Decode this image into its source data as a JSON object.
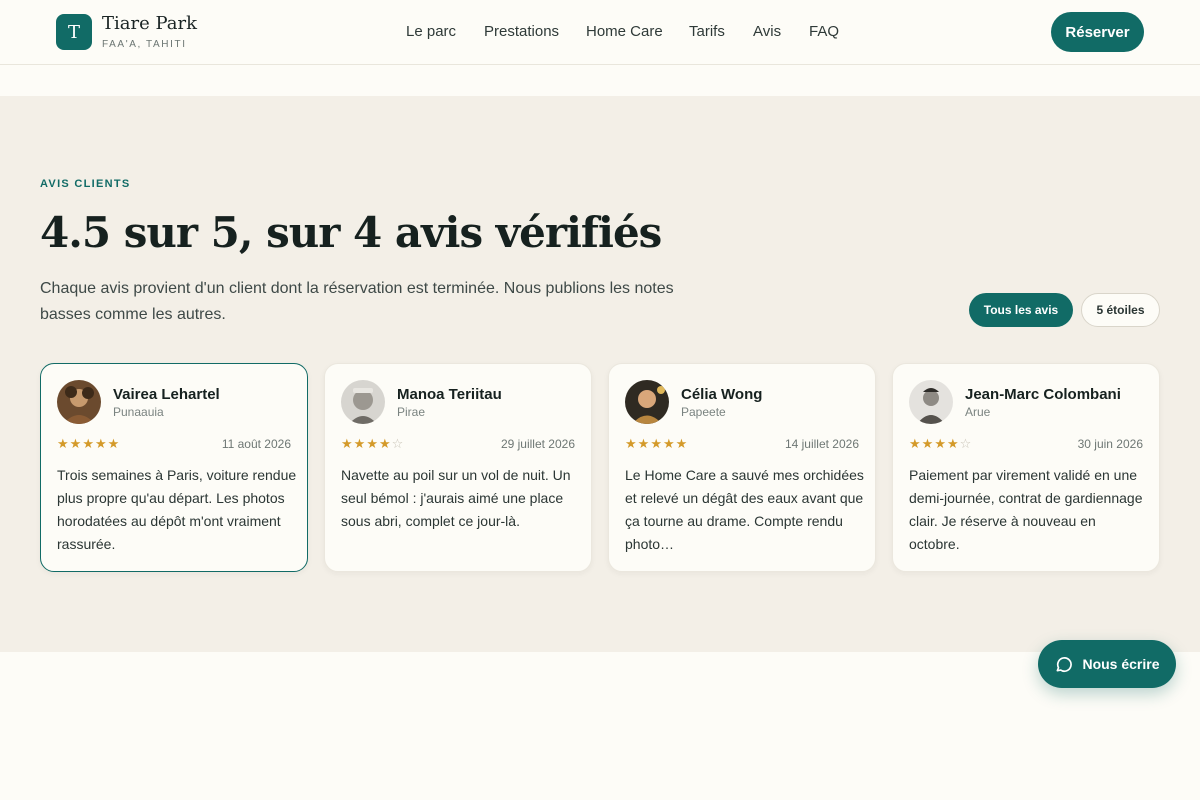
{
  "header": {
    "logo_letter": "T",
    "brand_name": "Tiare Park",
    "brand_sub": "FAA'A, TAHITI",
    "nav": [
      "Le parc",
      "Prestations",
      "Home Care",
      "Tarifs",
      "Avis",
      "FAQ"
    ],
    "cta_label": "Réserver"
  },
  "reviews": {
    "eyebrow": "AVIS CLIENTS",
    "heading": "4.5 sur 5, sur 4 avis vérifiés",
    "intro": "Chaque avis provient d'un client dont la réservation est terminée. Nous publions les notes basses comme les autres.",
    "filters": [
      "Tous les avis",
      "5 étoiles"
    ],
    "items": [
      {
        "name": "Vairea Lehartel",
        "city": "Punaauia",
        "date": "11 août 2026",
        "rating": 5,
        "text": "Trois semaines à Paris, voiture rendue plus propre qu'au départ. Les photos horodatées au dépôt m'ont vraiment rassurée."
      },
      {
        "name": "Manoa Teriitau",
        "city": "Pirae",
        "date": "29 juillet 2026",
        "rating": 4,
        "text": "Navette au poil sur un vol de nuit. Un seul bémol : j'aurais aimé une place sous abri, complet ce jour-là."
      },
      {
        "name": "Célia Wong",
        "city": "Papeete",
        "date": "14 juillet 2026",
        "rating": 5,
        "text": "Le Home Care a sauvé mes orchidées et relevé un dégât des eaux avant que ça tourne au drame. Compte rendu photo…"
      },
      {
        "name": "Jean-Marc Colombani",
        "city": "Arue",
        "date": "30 juin 2026",
        "rating": 4,
        "text": "Paiement par virement validé en une demi-journée, contrat de gardiennage clair. Je réserve à nouveau en octobre."
      }
    ]
  },
  "chat": {
    "label": "Nous écrire",
    "icon": "chat-bubble-icon"
  },
  "colors": {
    "accent": "#116b66",
    "star": "#d49a2a",
    "section_bg": "#f3efe7",
    "page_bg": "#fdfcf7"
  }
}
